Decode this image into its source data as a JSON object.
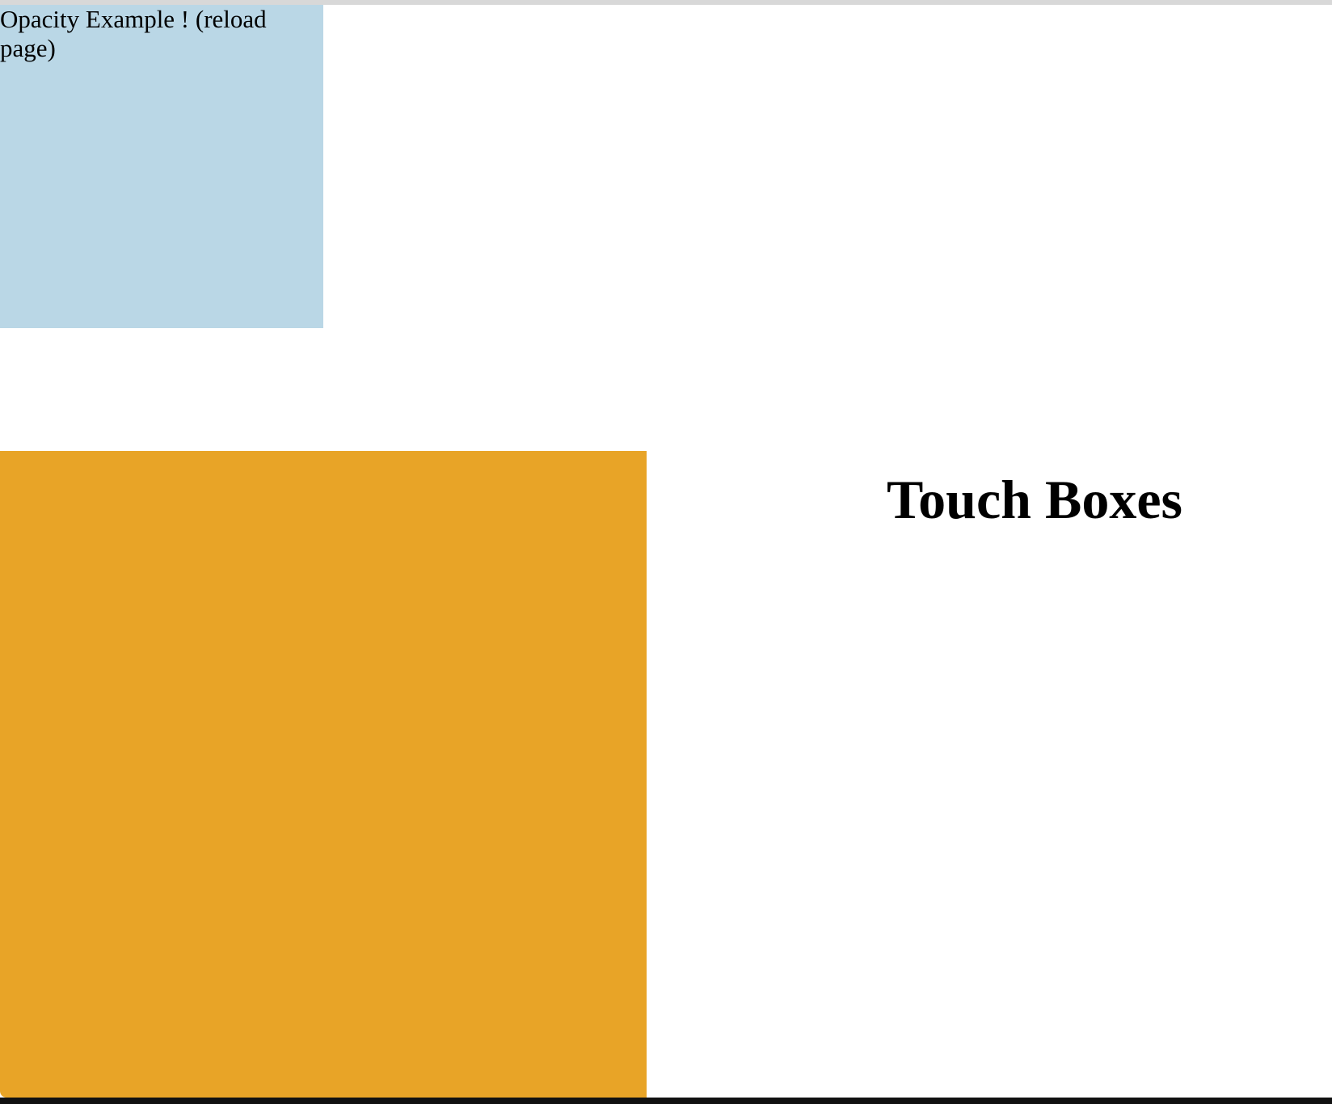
{
  "opacity_box": {
    "label": "Opacity Example ! (reload page)",
    "color": "#bad7e6"
  },
  "touch_box": {
    "color": "#e8a427"
  },
  "page": {
    "title": "Touch Boxes"
  }
}
